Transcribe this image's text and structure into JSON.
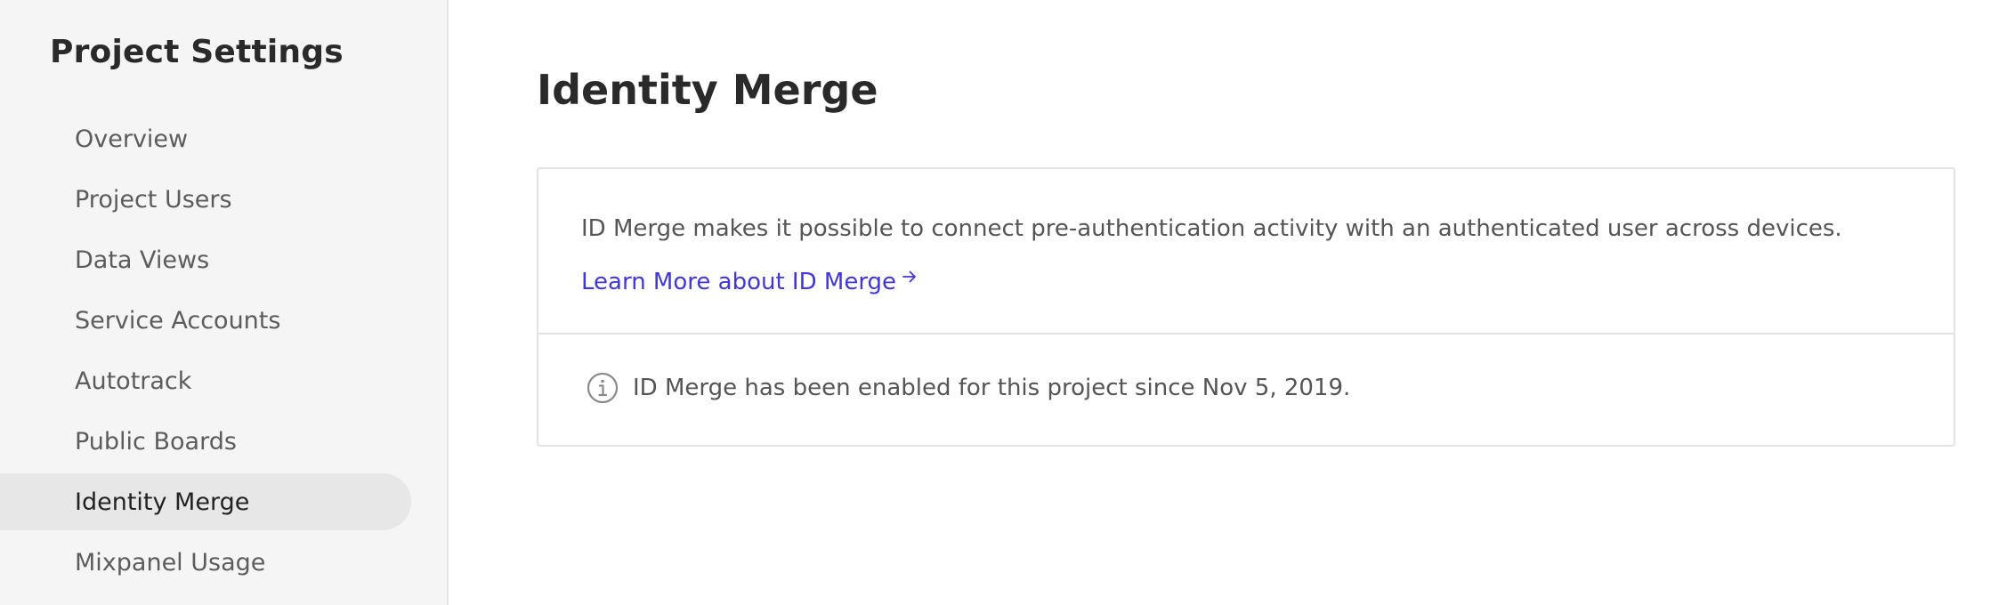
{
  "sidebar": {
    "title": "Project Settings",
    "items": [
      {
        "label": "Overview",
        "active": false
      },
      {
        "label": "Project Users",
        "active": false
      },
      {
        "label": "Data Views",
        "active": false
      },
      {
        "label": "Service Accounts",
        "active": false
      },
      {
        "label": "Autotrack",
        "active": false
      },
      {
        "label": "Public Boards",
        "active": false
      },
      {
        "label": "Identity Merge",
        "active": true
      },
      {
        "label": "Mixpanel Usage",
        "active": false
      }
    ]
  },
  "main": {
    "title": "Identity Merge",
    "card": {
      "description": "ID Merge makes it possible to connect pre-authentication activity with an authenticated user across devices.",
      "link_label": "Learn More about ID Merge",
      "link_icon": "arrow-right-icon",
      "info_icon": "info-icon",
      "info_text": "ID Merge has been enabled for this project since Nov 5, 2019."
    }
  },
  "colors": {
    "link": "#4137d6",
    "sidebar_bg": "#f5f5f5",
    "active_item_bg": "#e7e7e7"
  }
}
